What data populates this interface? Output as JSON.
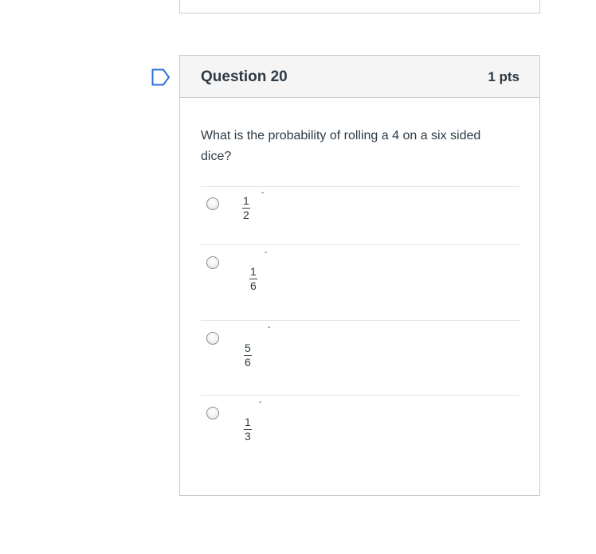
{
  "question": {
    "title": "Question 20",
    "points": "1 pts",
    "text": "What is the probability of rolling a 4 on a six sided dice?"
  },
  "answers": [
    {
      "numerator": "1",
      "denominator": "2",
      "mark": "-"
    },
    {
      "numerator": "1",
      "denominator": "6",
      "mark": "-"
    },
    {
      "numerator": "5",
      "denominator": "6",
      "mark": "-"
    },
    {
      "numerator": "1",
      "denominator": "3",
      "mark": "-"
    }
  ],
  "icons": {
    "flag": "flag-question-icon"
  },
  "colors": {
    "accent": "#2d72d9",
    "border": "#c7cdd1",
    "header_bg": "#f5f5f5",
    "text": "#2d3b45"
  }
}
